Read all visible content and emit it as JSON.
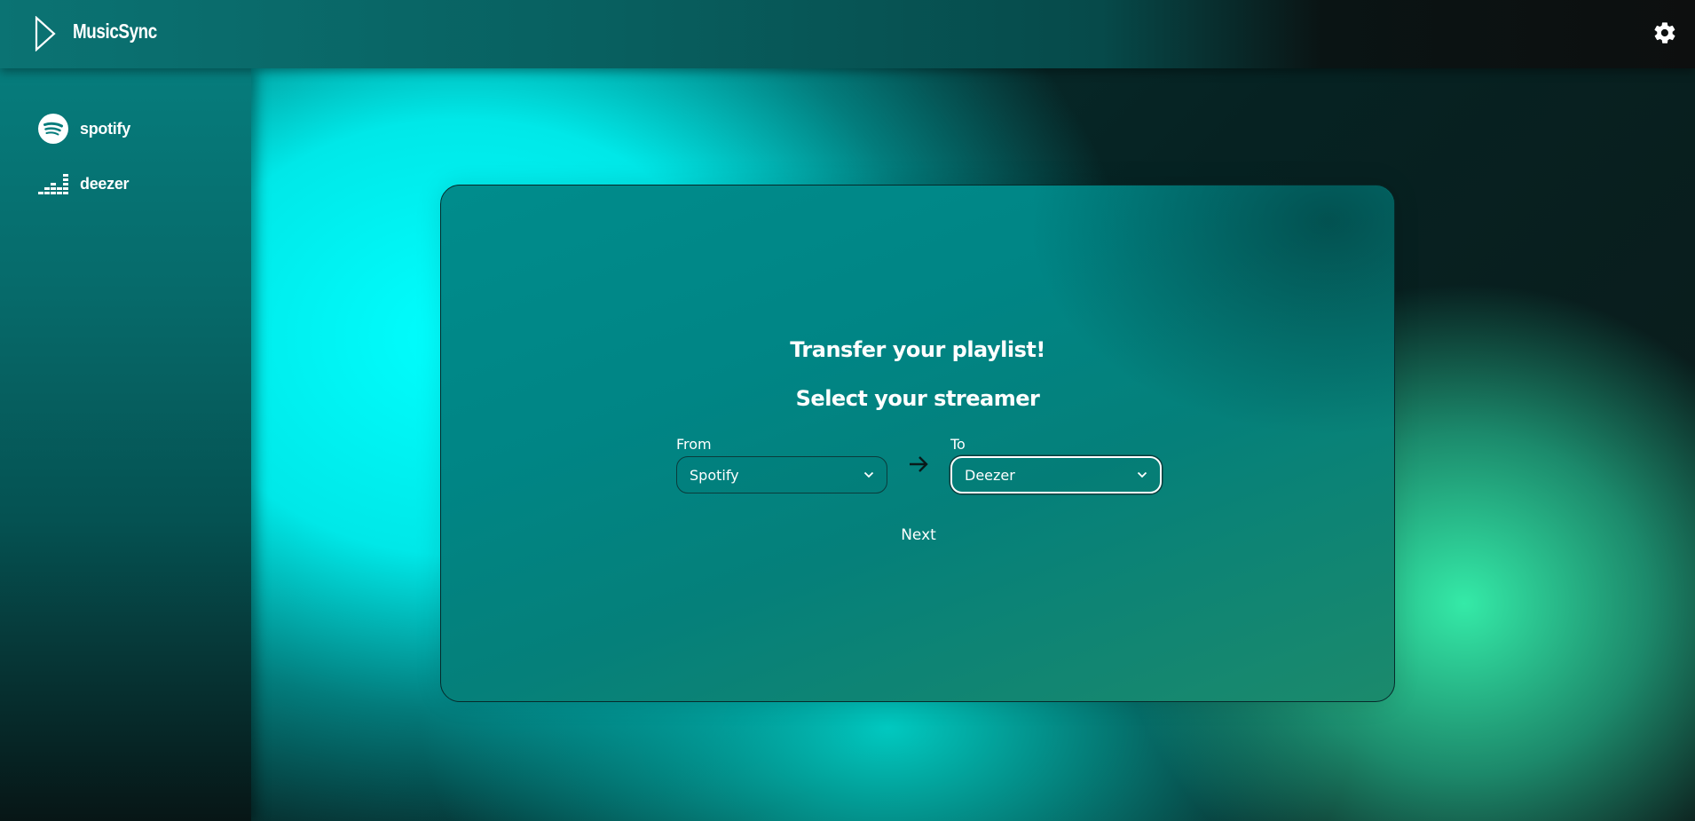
{
  "app": {
    "title": "MusicSync"
  },
  "header": {
    "logo_icon": "play-outline-icon",
    "settings_icon": "gear-icon"
  },
  "sidebar": {
    "items": [
      {
        "label": "spotify",
        "icon": "spotify-icon"
      },
      {
        "label": "deezer",
        "icon": "deezer-icon"
      }
    ]
  },
  "main": {
    "heading": "Transfer your playlist!",
    "subheading": "Select your streamer",
    "from": {
      "label": "From",
      "value": "Spotify"
    },
    "to": {
      "label": "To",
      "value": "Deezer"
    },
    "arrow_icon": "arrow-right-icon",
    "next_label": "Next"
  },
  "colors": {
    "primary": "#008c8c",
    "accent_cyan": "#00ffff",
    "accent_green": "#37f5af",
    "text": "#ffffff"
  }
}
